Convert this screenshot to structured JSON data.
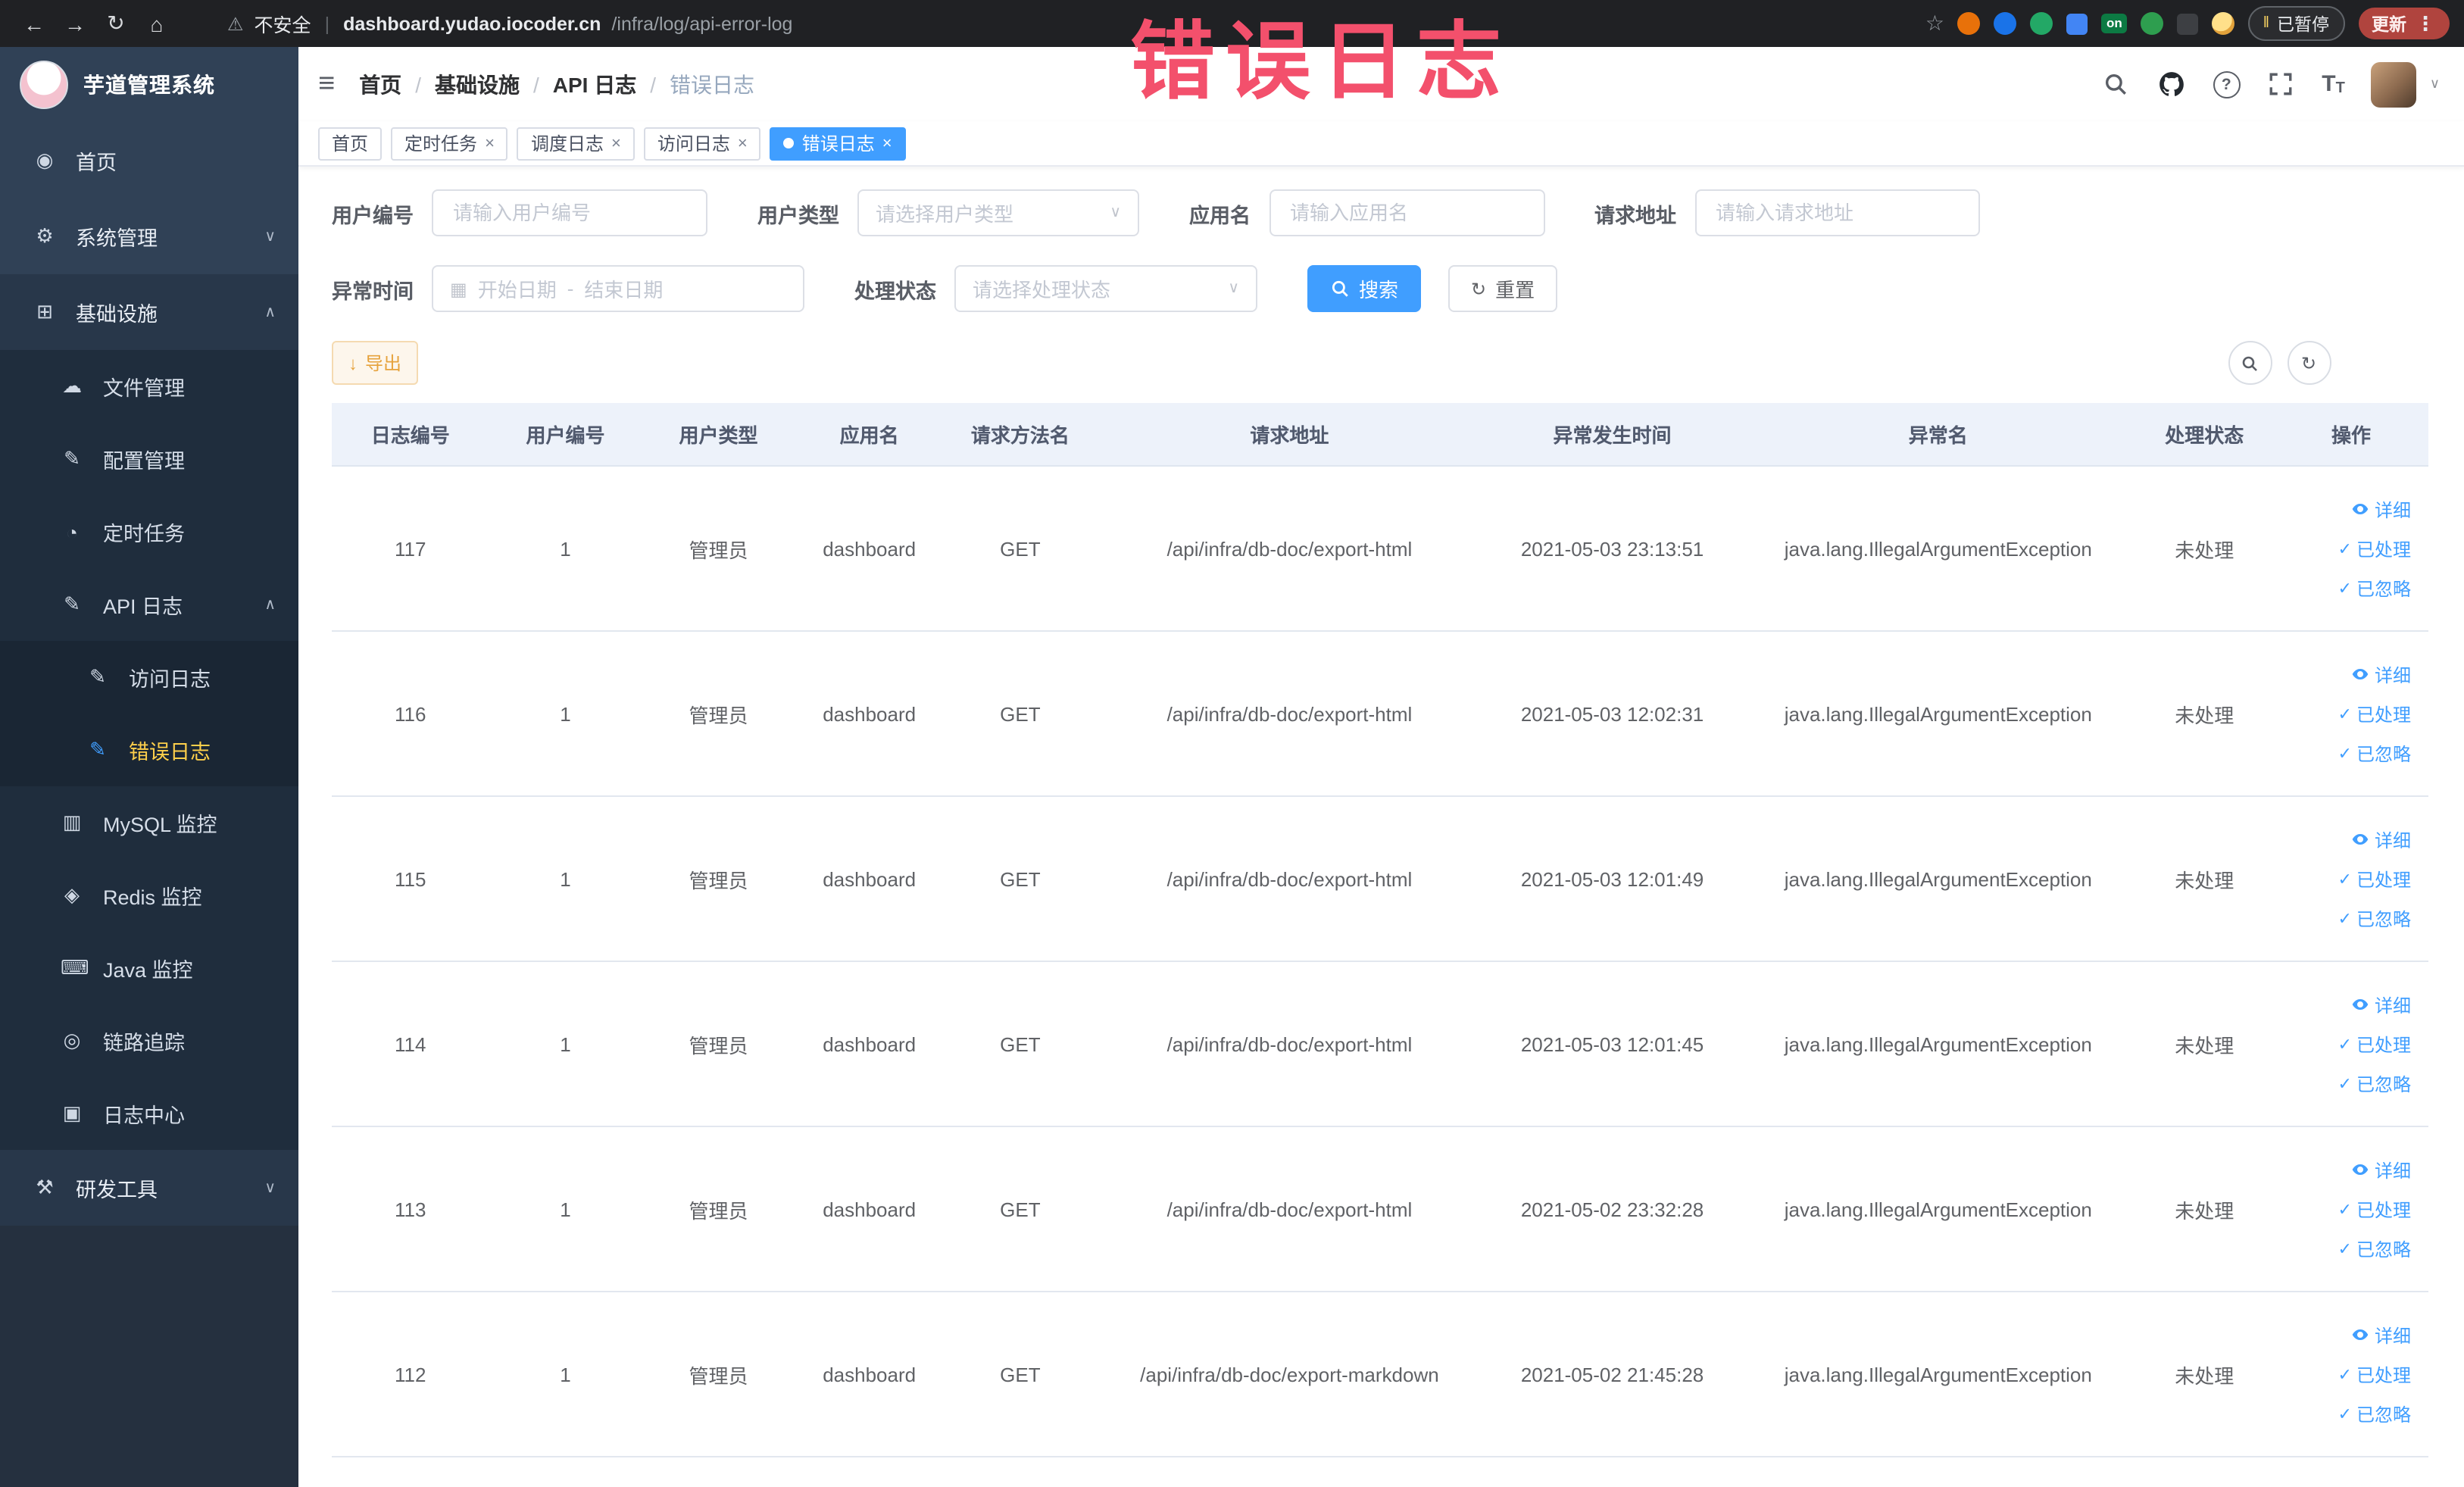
{
  "annotation": {
    "text": "错误日志",
    "color": "#f3506c"
  },
  "browser": {
    "security": "不安全",
    "url_host": "dashboard.yudao.iocoder.cn",
    "url_path": "/infra/log/api-error-log",
    "paused_label": "已暂停",
    "update_label": "更新",
    "ext_badge": "on"
  },
  "icons": {
    "back": "←",
    "forward": "→",
    "reload": "↻",
    "home": "⌂",
    "warning": "⚠",
    "divider": "|",
    "star": "☆",
    "kebab": "⋮",
    "pause": "‖",
    "hamburger": "≡",
    "slash": "/",
    "caret_down": "∨",
    "caret_up": "∧",
    "menu_home": "◉",
    "gear": "⚙",
    "grid": "⊞",
    "cloud": "☁",
    "pencil": "✎",
    "clock": "◔",
    "doc": "▤",
    "db": "▥",
    "redis": "◈",
    "java": "⌨",
    "eye": "◎",
    "log": "▣",
    "tools": "⚒",
    "calendar": "▦",
    "range_sep": "-",
    "refresh": "↻",
    "columns": "⊞",
    "download": "↓",
    "close": "×",
    "check": "✓",
    "dot": "●",
    "tsize_big": "T",
    "tsize_small": "T"
  },
  "sidebar": {
    "title": "芋道管理系统",
    "items": {
      "home": "首页",
      "system": "系统管理",
      "infra": "基础设施",
      "file": "文件管理",
      "config": "配置管理",
      "job": "定时任务",
      "api_log": "API 日志",
      "access_log": "访问日志",
      "error_log": "错误日志",
      "mysql": "MySQL 监控",
      "redis": "Redis 监控",
      "java": "Java 监控",
      "trace": "链路追踪",
      "log_center": "日志中心",
      "dev_tools": "研发工具"
    }
  },
  "header": {
    "breadcrumb": [
      "首页",
      "基础设施",
      "API 日志",
      "错误日志"
    ]
  },
  "tags": [
    {
      "label": "首页"
    },
    {
      "label": "定时任务"
    },
    {
      "label": "调度日志"
    },
    {
      "label": "访问日志"
    },
    {
      "label": "错误日志"
    }
  ],
  "filters": {
    "user_id": {
      "label": "用户编号",
      "placeholder": "请输入用户编号"
    },
    "user_type": {
      "label": "用户类型",
      "placeholder": "请选择用户类型"
    },
    "app_name": {
      "label": "应用名",
      "placeholder": "请输入应用名"
    },
    "request_url": {
      "label": "请求地址",
      "placeholder": "请输入请求地址"
    },
    "exception_time": {
      "label": "异常时间",
      "start_placeholder": "开始日期",
      "end_placeholder": "结束日期",
      "separator": "-"
    },
    "process_status": {
      "label": "处理状态",
      "placeholder": "请选择处理状态"
    },
    "search_label": "搜索",
    "reset_label": "重置"
  },
  "toolbar": {
    "export_label": "导出"
  },
  "table": {
    "columns": [
      "日志编号",
      "用户编号",
      "用户类型",
      "应用名",
      "请求方法名",
      "请求地址",
      "异常发生时间",
      "异常名",
      "处理状态",
      "操作"
    ],
    "actions": {
      "detail": "详细",
      "processed": "已处理",
      "ignored": "已忽略"
    },
    "rows": [
      {
        "id": "117",
        "user_id": "1",
        "user_type": "管理员",
        "app": "dashboard",
        "method": "GET",
        "url": "/api/infra/db-doc/export-html",
        "time": "2021-05-03 23:13:51",
        "exception": "java.lang.IllegalArgumentException",
        "status": "未处理"
      },
      {
        "id": "116",
        "user_id": "1",
        "user_type": "管理员",
        "app": "dashboard",
        "method": "GET",
        "url": "/api/infra/db-doc/export-html",
        "time": "2021-05-03 12:02:31",
        "exception": "java.lang.IllegalArgumentException",
        "status": "未处理"
      },
      {
        "id": "115",
        "user_id": "1",
        "user_type": "管理员",
        "app": "dashboard",
        "method": "GET",
        "url": "/api/infra/db-doc/export-html",
        "time": "2021-05-03 12:01:49",
        "exception": "java.lang.IllegalArgumentException",
        "status": "未处理"
      },
      {
        "id": "114",
        "user_id": "1",
        "user_type": "管理员",
        "app": "dashboard",
        "method": "GET",
        "url": "/api/infra/db-doc/export-html",
        "time": "2021-05-03 12:01:45",
        "exception": "java.lang.IllegalArgumentException",
        "status": "未处理"
      },
      {
        "id": "113",
        "user_id": "1",
        "user_type": "管理员",
        "app": "dashboard",
        "method": "GET",
        "url": "/api/infra/db-doc/export-html",
        "time": "2021-05-02 23:32:28",
        "exception": "java.lang.IllegalArgumentException",
        "status": "未处理"
      },
      {
        "id": "112",
        "user_id": "1",
        "user_type": "管理员",
        "app": "dashboard",
        "method": "GET",
        "url": "/api/infra/db-doc/export-markdown",
        "time": "2021-05-02 21:45:28",
        "exception": "java.lang.IllegalArgumentException",
        "status": "未处理"
      }
    ]
  }
}
